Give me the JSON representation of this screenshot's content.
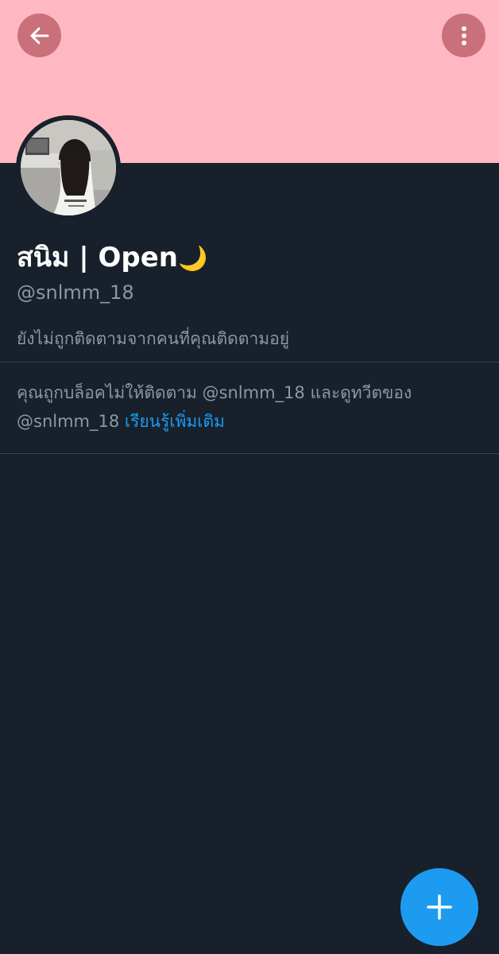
{
  "header": {
    "back_icon": "arrow-left-icon",
    "more_icon": "more-vertical-icon",
    "banner_color": "#ffb8c1"
  },
  "profile": {
    "display_name": "สนิม | Open",
    "display_name_emoji": "🌙",
    "handle": "@snlmm_18",
    "follow_status": "ยังไม่ถูกติดตามจากคนที่คุณติดตามอยู่"
  },
  "blocked_notice": {
    "text": "คุณถูกบล็อคไม่ให้ติดตาม @snlmm_18 และดูทวีตของ @snlmm_18 ",
    "learn_more": "เรียนรู้เพิ่มเติม"
  },
  "fab": {
    "icon": "plus-icon"
  },
  "colors": {
    "background": "#17202b",
    "accent": "#1d9bf0",
    "secondary_text": "#8b98a5",
    "divider": "#38444d"
  }
}
